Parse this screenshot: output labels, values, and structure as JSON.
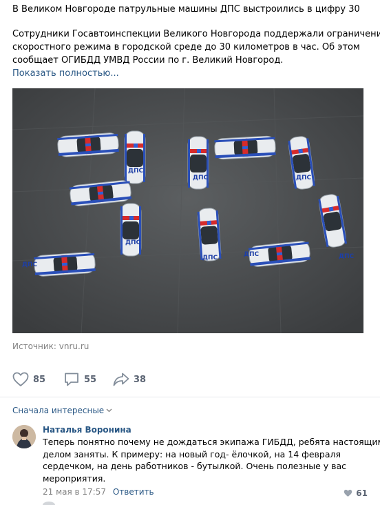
{
  "post": {
    "title": "В Великом Новгороде патрульные машины ДПС выстроились в цифру 30",
    "text_lines": [
      "Сотрудники Госавтоинспекции Великого Новгорода поддержали ограничение",
      "скоростного режима в городской среде до 30 километров в час. Об этом",
      "сообщает ОГИБДД УМВД России по г. Великий Новгород."
    ],
    "show_more": "Показать полностью...",
    "source_label": "Источник:",
    "source_link": "vnru.ru"
  },
  "actions": {
    "likes": "85",
    "comments": "55",
    "reposts": "38"
  },
  "photo": {
    "car_label": "ДПС",
    "colors": {
      "asphalt": "#4d4f51",
      "car_body": "#e9ecef",
      "stripe": "#2a4fb8",
      "light_red": "#d62b2b",
      "light_blue": "#2f5fd6"
    }
  },
  "comments": {
    "sort_label": "Сначала интересные",
    "items": [
      {
        "author": "Наталья Воронина",
        "text_lines": [
          "Теперь понятно почему не дождаться экипажа ГИБДД, ребята настоящим",
          "делом заняты. К примеру: на новый год- ёлочкой, на 14 февраля",
          "сердечком, на день работников - бутылкой. Очень полезные у вас",
          "мероприятия."
        ],
        "date": "21 мая в 17:57",
        "reply": "Ответить",
        "likes": "61"
      }
    ]
  },
  "colors": {
    "link": "#2a5885",
    "muted": "#828282",
    "counter": "#5b6473"
  }
}
